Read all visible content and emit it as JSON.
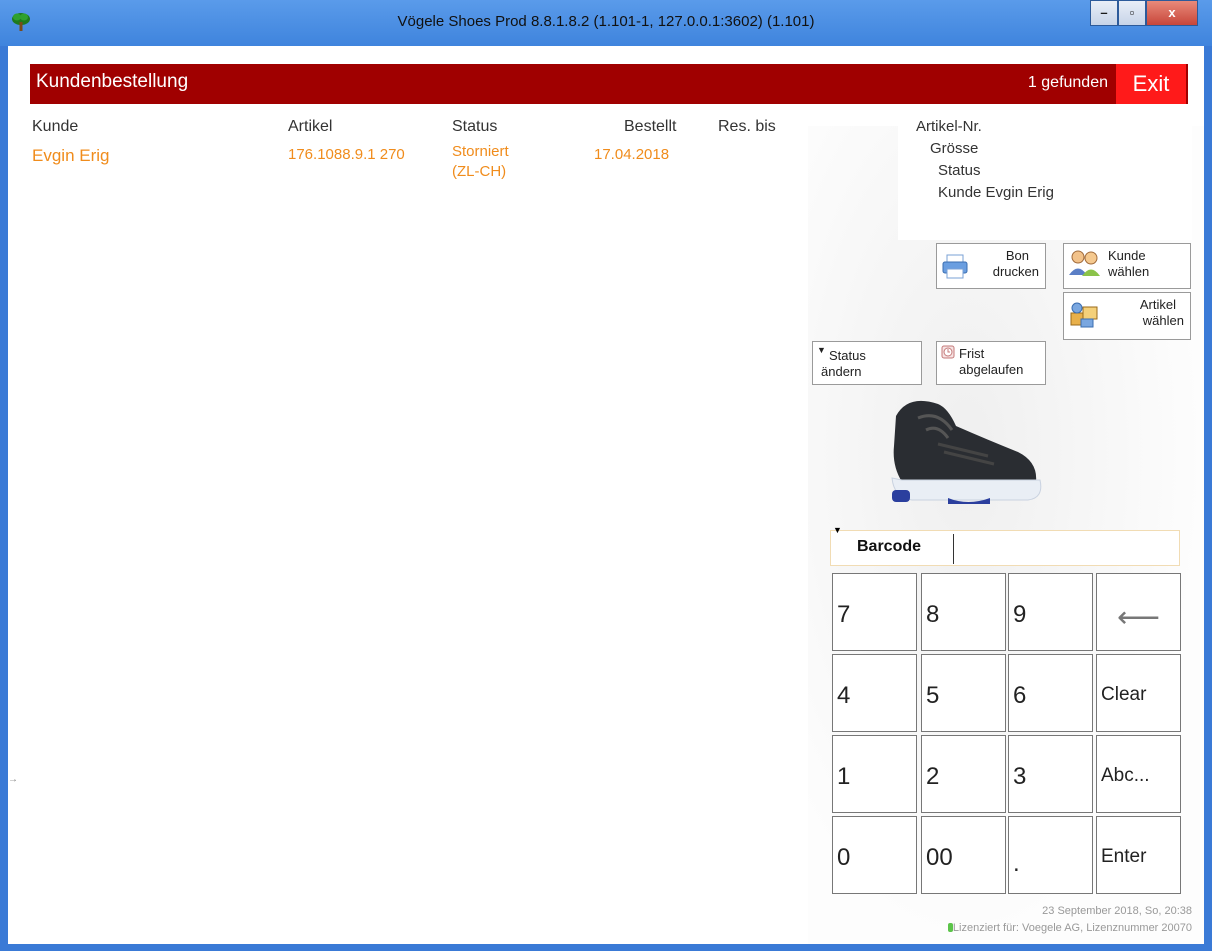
{
  "window": {
    "title": "Vögele Shoes Prod 8.8.1.8.2 (1.101-1, 127.0.0.1:3602) (1.101)",
    "min_label": "–",
    "max_label": "▫",
    "close_label": "x"
  },
  "header": {
    "title": "Kundenbestellung",
    "found": "1 gefunden",
    "exit": "Exit"
  },
  "table": {
    "columns": [
      "Kunde",
      "Artikel",
      "Status",
      "Bestellt",
      "Res. bis"
    ],
    "rows": [
      {
        "kunde": "Evgin Erig",
        "artikel": "176.1088.9.1  270",
        "status_line1": "Storniert",
        "status_line2": "(ZL-CH)",
        "bestellt": "17.04.2018",
        "res_bis": ""
      }
    ]
  },
  "detail": {
    "artikel_nr": "Artikel-Nr.",
    "groesse": "Grösse",
    "status": "Status",
    "kunde": "Kunde Evgin Erig"
  },
  "buttons": {
    "bon_1": "Bon",
    "bon_2": "drucken",
    "kunde_1": "Kunde",
    "kunde_2": "wählen",
    "artikel_1": "Artikel",
    "artikel_2": "wählen",
    "status_1": "Status",
    "status_2": "ändern",
    "frist_1": "Frist",
    "frist_2": "abgelaufen"
  },
  "barcode": {
    "label": "Barcode",
    "value": ""
  },
  "keypad": {
    "k7": "7",
    "k8": "8",
    "k9": "9",
    "back": "⟵",
    "k4": "4",
    "k5": "5",
    "k6": "6",
    "clear": "Clear",
    "k1": "1",
    "k2": "2",
    "k3": "3",
    "abc": "Abc...",
    "k0": "0",
    "k00": "00",
    "dot": ".",
    "enter": "Enter"
  },
  "footer": {
    "datetime": "23 September 2018, So, 20:38",
    "license": "Lizenziert für: Voegele AG, Lizenznummer 20070"
  },
  "colors": {
    "header_bg": "#a00000",
    "exit_bg": "#ff1a1a",
    "row_text": "#f08c1c"
  }
}
